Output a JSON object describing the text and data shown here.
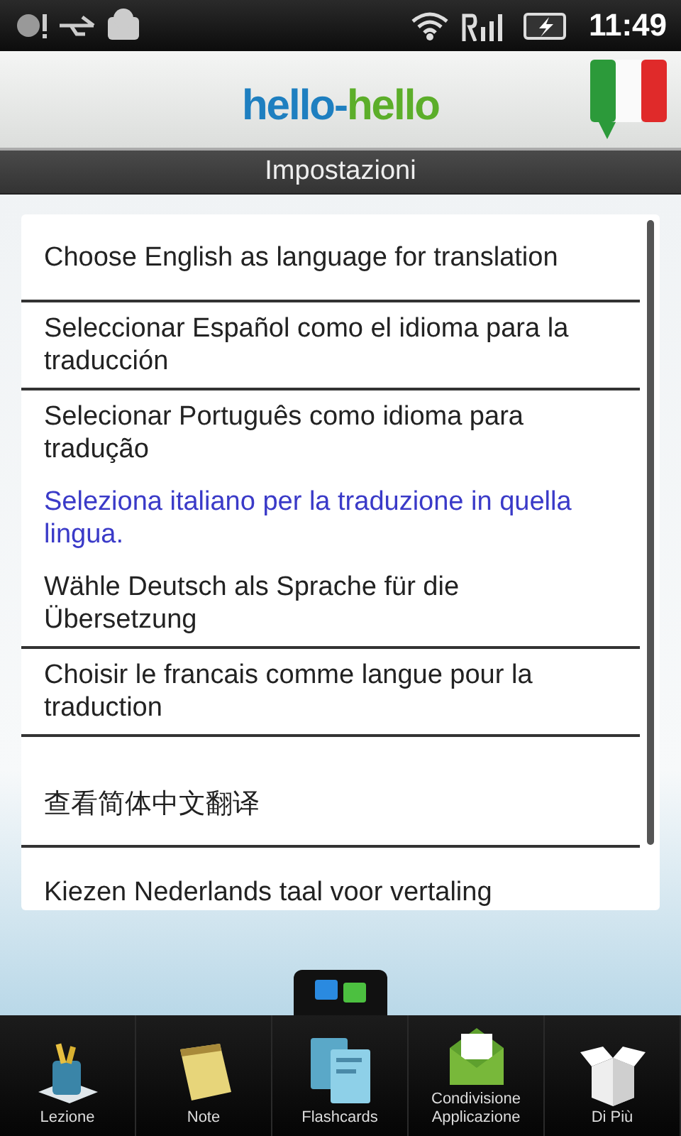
{
  "status_bar": {
    "time": "11:49"
  },
  "header": {
    "logo": [
      "hello-",
      "hello"
    ]
  },
  "title": "Impostazioni",
  "languages": [
    {
      "label": "Choose English as language for translation",
      "selected": false
    },
    {
      "label": "Seleccionar Español como el idioma para la traducción",
      "selected": false
    },
    {
      "label": "Selecionar Português como idioma para tradução",
      "selected": false
    },
    {
      "label": "Seleziona italiano per la traduzione in quella lingua.",
      "selected": true
    },
    {
      "label": "Wähle Deutsch als Sprache für die Übersetzung",
      "selected": false
    },
    {
      "label": "Choisir le francais comme langue pour la traduction",
      "selected": false
    },
    {
      "label": "查看简体中文翻译",
      "selected": false
    },
    {
      "label": "Kiezen Nederlands taal voor vertaling",
      "selected": false
    }
  ],
  "nav": [
    {
      "label": "Lezione",
      "kind": "lesson",
      "selected": false
    },
    {
      "label": "Note",
      "kind": "notes",
      "selected": false
    },
    {
      "label": "Flashcards",
      "kind": "flashcards",
      "selected": true
    },
    {
      "label": "Condivisione Applicazione",
      "kind": "share",
      "selected": false
    },
    {
      "label": "Di Più",
      "kind": "more",
      "selected": false
    }
  ]
}
